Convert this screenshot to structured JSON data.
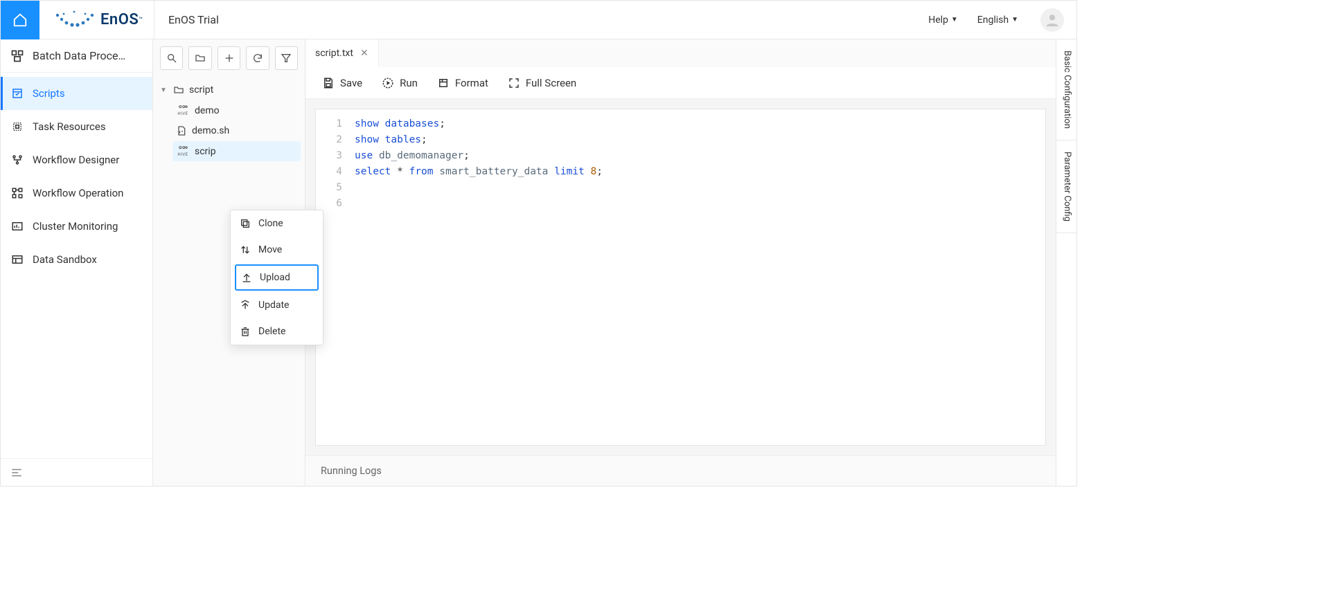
{
  "header": {
    "brand": "EnOS",
    "app_title": "EnOS Trial",
    "help": "Help",
    "language": "English"
  },
  "leftnav": {
    "title": "Batch Data Proce…",
    "items": [
      {
        "label": "Scripts",
        "active": true
      },
      {
        "label": "Task Resources",
        "active": false
      },
      {
        "label": "Workflow Designer",
        "active": false
      },
      {
        "label": "Workflow Operation",
        "active": false
      },
      {
        "label": "Cluster Monitoring",
        "active": false
      },
      {
        "label": "Data Sandbox",
        "active": false
      }
    ]
  },
  "tree": {
    "root": "script",
    "items": [
      {
        "label": "demo",
        "kind": "hive"
      },
      {
        "label": "demo.sh",
        "kind": "sh"
      },
      {
        "label": "scrip",
        "kind": "hive",
        "selected": true
      }
    ]
  },
  "context_menu": {
    "items": [
      {
        "label": "Clone"
      },
      {
        "label": "Move"
      },
      {
        "label": "Upload",
        "highlight": true
      },
      {
        "label": "Update"
      },
      {
        "label": "Delete"
      }
    ]
  },
  "editor": {
    "tab": "script.txt",
    "toolbar": {
      "save": "Save",
      "run": "Run",
      "format": "Format",
      "fullscreen": "Full Screen"
    },
    "gutter": [
      "1",
      "2",
      "3",
      "4",
      "5",
      "6"
    ],
    "code": [
      [
        {
          "t": "show",
          "c": "kw"
        },
        {
          "t": " "
        },
        {
          "t": "databases",
          "c": "kw"
        },
        {
          "t": ";",
          "c": "punct"
        }
      ],
      [
        {
          "t": "show",
          "c": "kw"
        },
        {
          "t": " "
        },
        {
          "t": "tables",
          "c": "kw"
        },
        {
          "t": ";",
          "c": "punct"
        }
      ],
      [
        {
          "t": "use",
          "c": "kw"
        },
        {
          "t": " "
        },
        {
          "t": "db_demomanager",
          "c": "id"
        },
        {
          "t": ";",
          "c": "punct"
        }
      ],
      [
        {
          "t": "select",
          "c": "kw"
        },
        {
          "t": " * "
        },
        {
          "t": "from",
          "c": "kw"
        },
        {
          "t": " "
        },
        {
          "t": "smart_battery_data",
          "c": "id"
        },
        {
          "t": " "
        },
        {
          "t": "limit",
          "c": "kw"
        },
        {
          "t": " "
        },
        {
          "t": "8",
          "c": "num"
        },
        {
          "t": ";",
          "c": "punct"
        }
      ],
      [],
      []
    ],
    "logs_label": "Running Logs"
  },
  "rightrail": {
    "tabs": [
      "Basic Configuration",
      "Parameter Config"
    ]
  }
}
